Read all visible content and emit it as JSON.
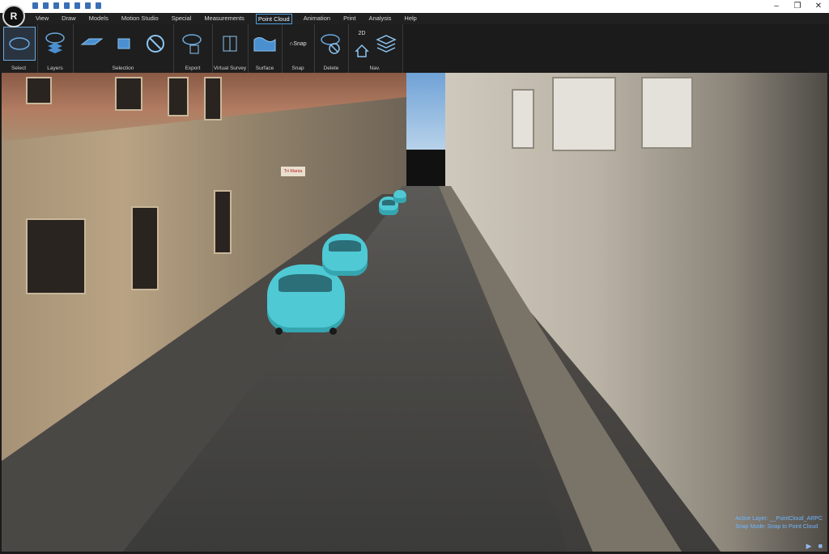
{
  "app": {
    "logo_letter": "R"
  },
  "window_controls": {
    "minimize": "–",
    "restore": "❐",
    "close": "✕"
  },
  "menu": [
    "View",
    "Draw",
    "Models",
    "Motion Studio",
    "Special",
    "Measurements",
    "Point Cloud",
    "Animation",
    "Print",
    "Analysis",
    "Help"
  ],
  "menu_active": "Point Cloud",
  "ribbon": {
    "select": "Select",
    "layers": "Layers",
    "selection": "Selection",
    "export": "Export",
    "virtual_survey": "Virtual Survey",
    "surface": "Surface",
    "snap": "Snap",
    "snap_button": "Snap",
    "delete": "Delete",
    "nav": "Nav.",
    "nav_2d": "2D"
  },
  "status": {
    "active_layer": "Active Layer: __PointCloud_ARPC",
    "snap_mode": "Snap Mode: Snap to Point Cloud"
  },
  "scene": {
    "sign_text": "Tri Mania"
  },
  "colors": {
    "accent": "#4a9fe0",
    "car": "#4fc9d4",
    "status_text": "#6fb6ff"
  }
}
